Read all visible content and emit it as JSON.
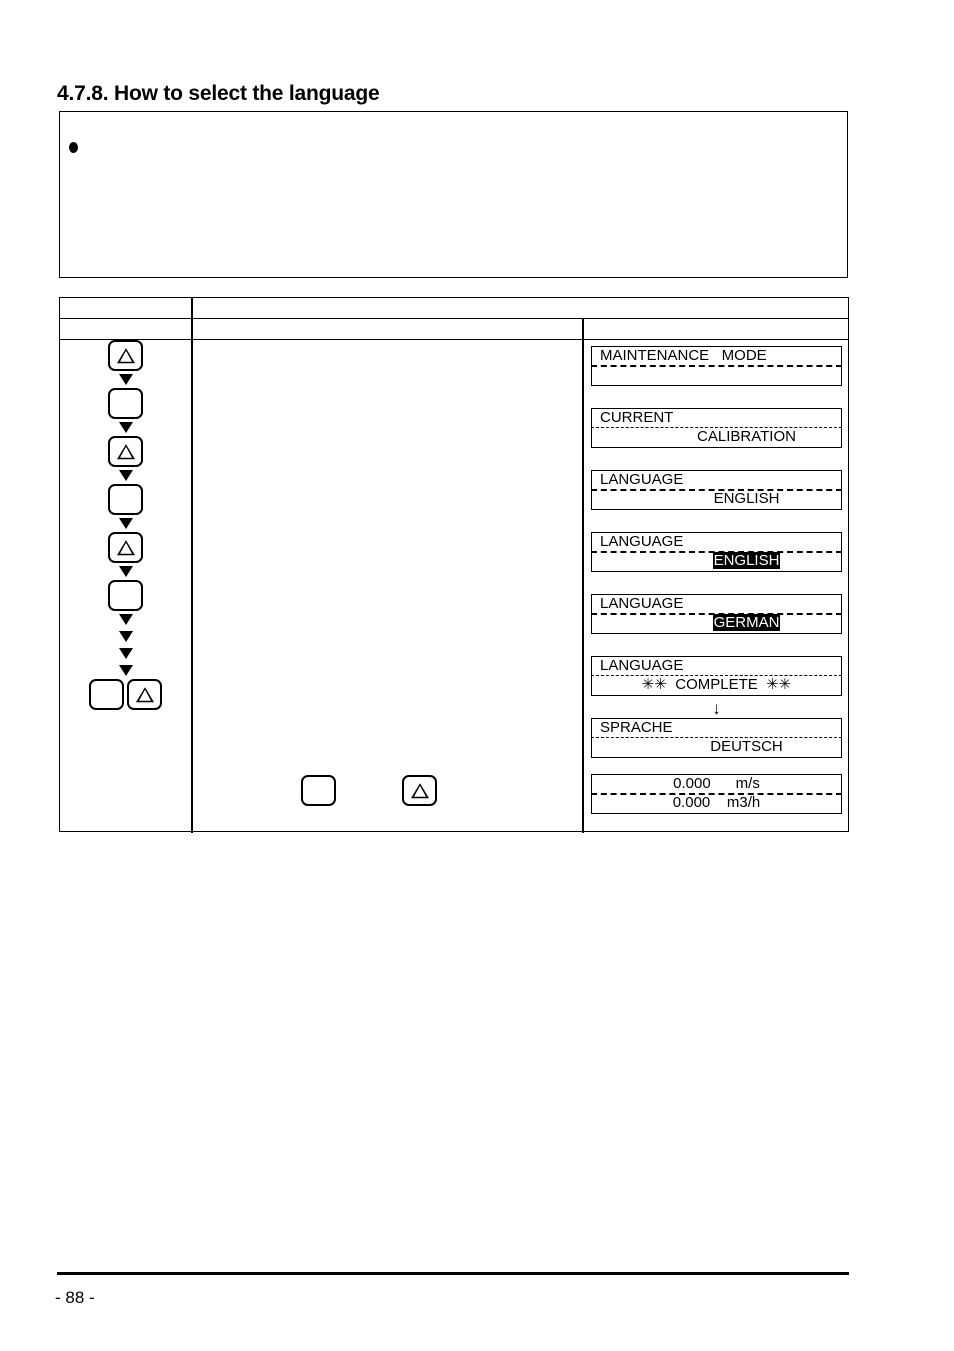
{
  "document": {
    "heading": "4.7.8. How to select the language",
    "page_number": "- 88 -"
  },
  "note_box": {
    "bullet_text": ""
  },
  "procedure_table": {
    "headers_row1": {
      "col1": "",
      "col2": ""
    },
    "headers_row2": {
      "col1": "",
      "col2": "",
      "col3": ""
    },
    "key_sequence": [
      {
        "type": "key",
        "icon": "triangle-key",
        "label": ""
      },
      {
        "type": "arrow",
        "icon": "down-arrow-icon"
      },
      {
        "type": "key",
        "icon": "blank-key",
        "label": ""
      },
      {
        "type": "arrow",
        "icon": "down-arrow-icon"
      },
      {
        "type": "key",
        "icon": "triangle-key",
        "label": ""
      },
      {
        "type": "arrow",
        "icon": "down-arrow-icon"
      },
      {
        "type": "key",
        "icon": "blank-key",
        "label": ""
      },
      {
        "type": "arrow",
        "icon": "down-arrow-icon"
      },
      {
        "type": "key",
        "icon": "triangle-key",
        "label": ""
      },
      {
        "type": "arrow",
        "icon": "down-arrow-icon"
      },
      {
        "type": "key",
        "icon": "blank-key",
        "label": ""
      },
      {
        "type": "arrow",
        "icon": "down-arrow-icon"
      },
      {
        "type": "arrow",
        "icon": "down-arrow-icon"
      },
      {
        "type": "arrow",
        "icon": "down-arrow-icon"
      },
      {
        "type": "arrow",
        "icon": "down-arrow-icon"
      },
      {
        "type": "key-pair",
        "icons": [
          "blank-key",
          "triangle-key"
        ]
      }
    ],
    "action_texts": [
      "",
      "",
      "",
      "",
      "",
      "",
      ""
    ],
    "mid_keys": [
      {
        "icon": "blank-key"
      },
      {
        "icon": "triangle-key"
      }
    ],
    "displays": [
      {
        "name": "maintenance-mode",
        "line1": "MAINTENANCE   MODE",
        "line2": "",
        "line1_highlight": false,
        "line2_highlight": false,
        "line1_align": "left",
        "line2_align": "left",
        "divider": "bold"
      },
      {
        "name": "current-calibration",
        "line1": "CURRENT",
        "line2": "CALIBRATION",
        "line1_highlight": false,
        "line2_highlight": false,
        "line1_align": "left",
        "line2_align": "center",
        "divider": "fine"
      },
      {
        "name": "language-english",
        "line1": "LANGUAGE",
        "line2": "ENGLISH",
        "line1_highlight": false,
        "line2_highlight": false,
        "line1_align": "left",
        "line2_align": "center",
        "divider": "bold"
      },
      {
        "name": "language-english-selected",
        "line1": "LANGUAGE",
        "line2": "ENGLISH",
        "line1_highlight": false,
        "line2_highlight": true,
        "line1_align": "left",
        "line2_align": "center",
        "divider": "bold"
      },
      {
        "name": "language-german-selected",
        "line1": "LANGUAGE",
        "line2": "GERMAN",
        "line1_highlight": false,
        "line2_highlight": true,
        "line1_align": "left",
        "line2_align": "center",
        "divider": "bold"
      },
      {
        "name": "language-complete",
        "line1": "LANGUAGE",
        "line2": "✳✳  COMPLETE  ✳✳",
        "line1_highlight": false,
        "line2_highlight": false,
        "line1_align": "left",
        "line2_align": "center",
        "divider": "fine"
      },
      {
        "name": "sprache-deutsch",
        "line1": "SPRACHE",
        "line2": "DEUTSCH",
        "line1_highlight": false,
        "line2_highlight": false,
        "line1_align": "left",
        "line2_align": "center",
        "divider": "fine"
      },
      {
        "name": "measurement-readout",
        "line1": "0.000      m/s",
        "line2": "0.000    m3/h",
        "line1_highlight": false,
        "line2_highlight": false,
        "line1_align": "center",
        "line2_align": "center",
        "divider": "bold"
      }
    ],
    "flow_arrow": "↓"
  }
}
